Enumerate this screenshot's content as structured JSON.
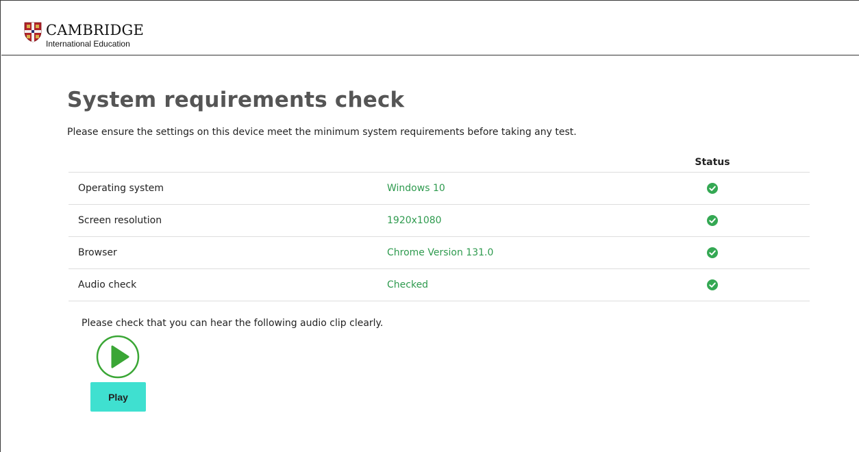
{
  "header": {
    "logo_main": "CAMBRIDGE",
    "logo_sub": "International Education"
  },
  "page": {
    "title": "System requirements check",
    "intro": "Please ensure the settings on this device meet the minimum system requirements before taking any test."
  },
  "table": {
    "status_header": "Status",
    "rows": [
      {
        "label": "Operating system",
        "value": "Windows 10",
        "status": "check-circle-icon"
      },
      {
        "label": "Screen resolution",
        "value": "1920x1080",
        "status": "check-circle-icon"
      },
      {
        "label": "Browser",
        "value": "Chrome Version 131.0",
        "status": "check-circle-icon"
      },
      {
        "label": "Audio check",
        "value": "Checked",
        "status": "check-circle-icon"
      }
    ]
  },
  "audio": {
    "prompt": "Please check that you can hear the following audio clip clearly.",
    "play_label": "Play",
    "play_icon": "play-circle-icon"
  },
  "colors": {
    "value_green": "#2e9a4e",
    "check_green": "#34a853",
    "play_green": "#3aa635",
    "play_button_bg": "#3fe0d0",
    "title_gray": "#555555"
  }
}
